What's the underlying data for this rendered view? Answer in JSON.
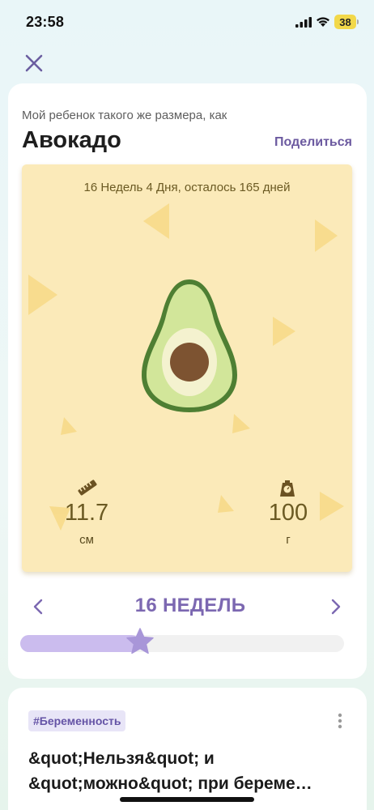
{
  "status_bar": {
    "time": "23:58",
    "battery": "38",
    "icons": [
      "signal-icon",
      "wifi-icon",
      "battery-icon"
    ]
  },
  "header": {
    "close_icon": "close-icon"
  },
  "size_card": {
    "subtitle": "Мой ребенок такого же размера, как",
    "fruit_name": "Авокадо",
    "share_label": "Поделиться",
    "week_info": "16 Недель 4 Дня, осталось 165 дней",
    "length": {
      "value": "11.7",
      "unit": "см",
      "icon": "ruler-icon"
    },
    "weight": {
      "value": "100",
      "unit": "г",
      "icon": "scale-icon"
    },
    "week_label": "16 НЕДЕЛЬ",
    "progress_fraction": 0.37,
    "colors": {
      "accent": "#7c68b1",
      "panel_background": "#fbeab9",
      "progress_fill": "#cbbcee",
      "thumb": "#a896d8"
    }
  },
  "article": {
    "tag": "#Беременность",
    "title_lines": [
      "&quot;Нельзя&quot; и",
      "&quot;можно&quot; при береме…"
    ]
  }
}
